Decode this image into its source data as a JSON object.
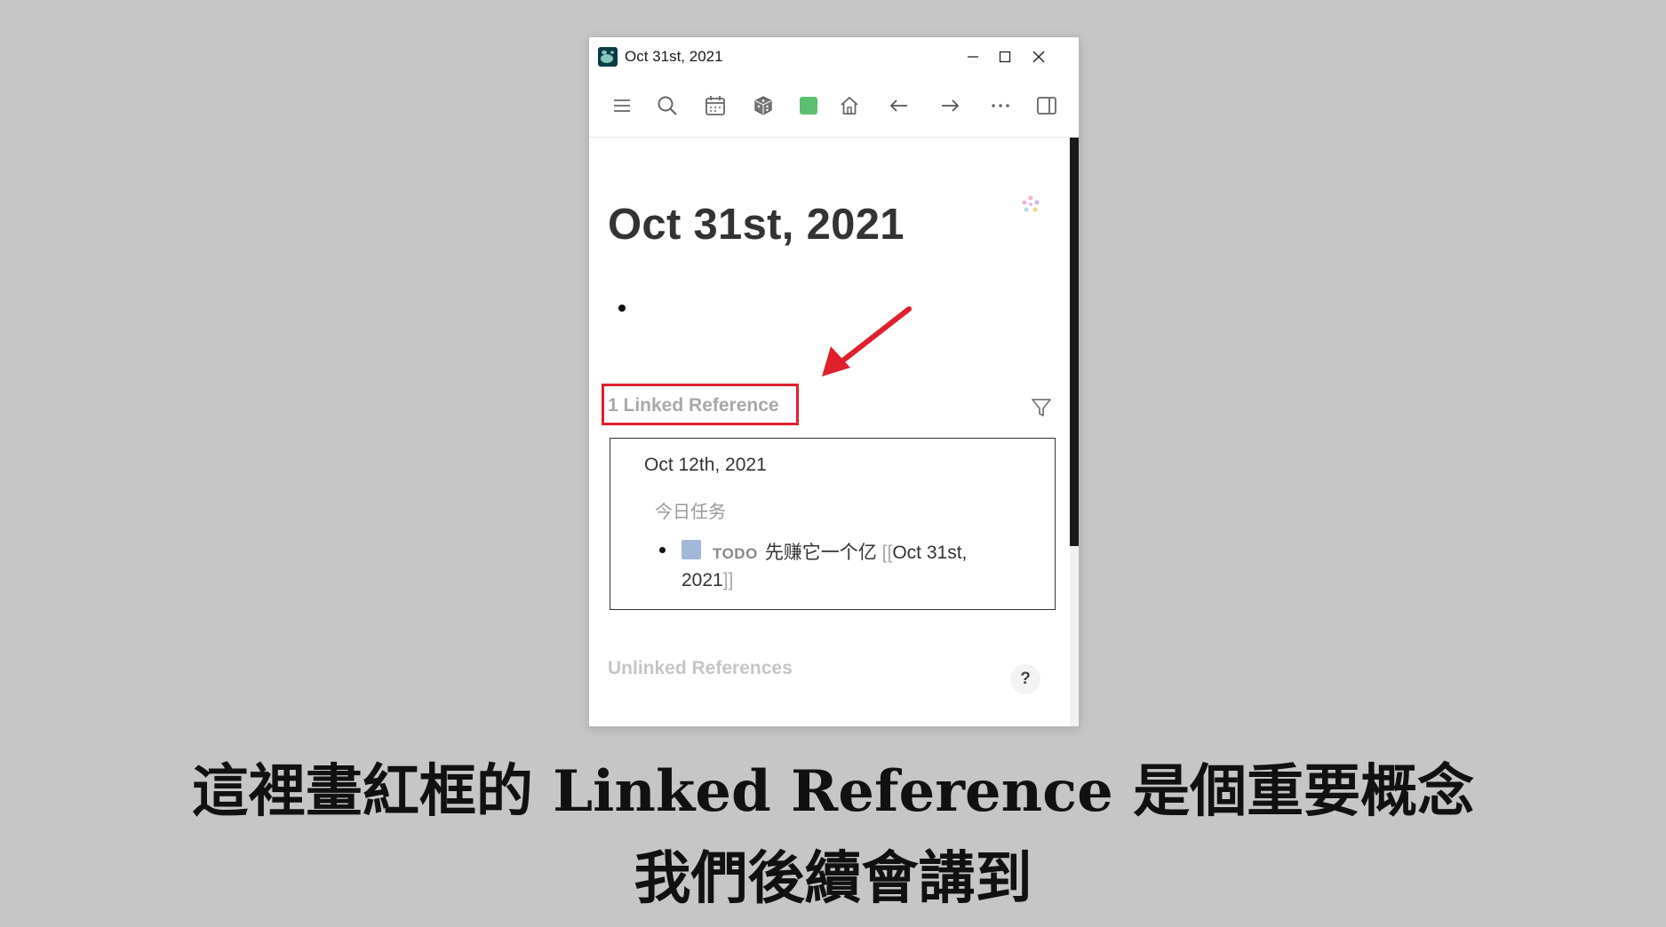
{
  "window": {
    "title": "Oct 31st, 2021"
  },
  "toolbar": {
    "icons": [
      "menu-icon",
      "search-icon",
      "calendar-icon",
      "dice-icon",
      "green-square-icon",
      "home-icon",
      "arrow-left-icon",
      "arrow-right-icon",
      "more-icon",
      "sidebar-toggle-icon"
    ],
    "green_square_color": "#5cbf6f"
  },
  "page": {
    "title": "Oct 31st, 2021",
    "linked_references_label": "1 Linked Reference",
    "unlinked_references_label": "Unlinked References",
    "help_label": "?"
  },
  "reference": {
    "date": "Oct 12th, 2021",
    "parent_block": "今日任务",
    "todo_marker": "TODO",
    "text": "先赚它一个亿",
    "open_bracket": "[[",
    "link_part1": "Oct 31st,",
    "link_part2": "2021",
    "close_bracket": "]]"
  },
  "annotation": {
    "highlight_color": "#e0202c"
  },
  "captions": {
    "line1": "這裡畫紅框的 Linked Reference 是個重要概念",
    "line2": "我們後續會講到"
  }
}
